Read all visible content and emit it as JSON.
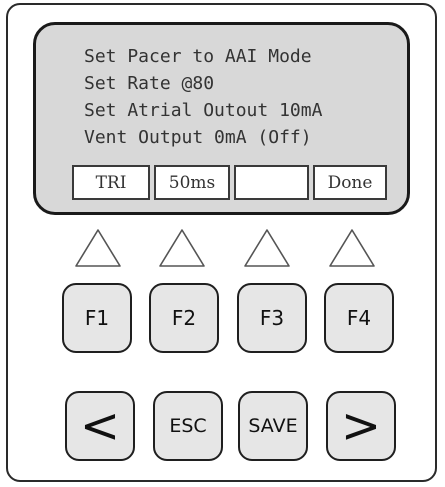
{
  "display": {
    "lines": [
      "Set Pacer to AAI Mode",
      "Set Rate @80",
      "Set Atrial Outout 10mA",
      "Vent Output 0mA (Off)"
    ],
    "softkeys": [
      "TRI",
      "50ms",
      "",
      "Done"
    ]
  },
  "function_keys": [
    "F1",
    "F2",
    "F3",
    "F4"
  ],
  "nav_keys": {
    "left": "<",
    "esc": "ESC",
    "save": "SAVE",
    "right": ">"
  },
  "colors": {
    "bezel": "#d8d8d8",
    "key_face": "#e6e6e6",
    "outline": "#1f1f1f"
  }
}
